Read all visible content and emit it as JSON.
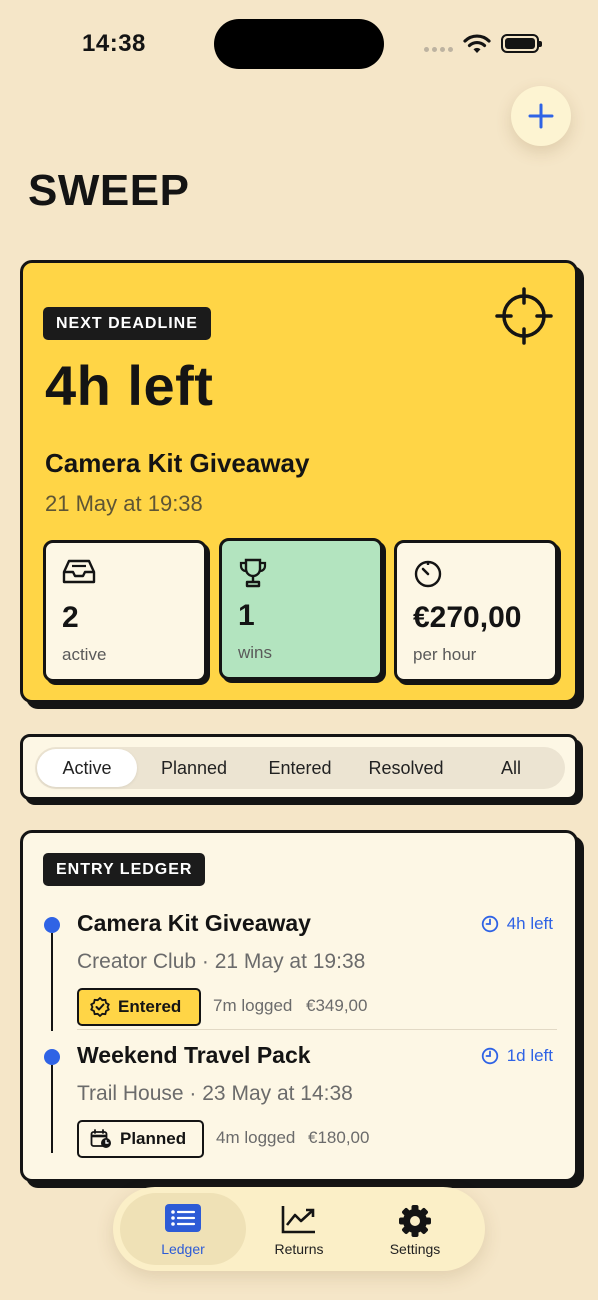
{
  "status": {
    "time": "14:38"
  },
  "header": {
    "title": "SWEEP",
    "add_icon": "plus-icon"
  },
  "hero": {
    "tag": "NEXT DEADLINE",
    "countdown": "4h left",
    "name": "Camera Kit Giveaway",
    "date": "21 May at 19:38",
    "stats": [
      {
        "value": "2",
        "label": "active",
        "icon": "inbox-icon"
      },
      {
        "value": "1",
        "label": "wins",
        "icon": "trophy-icon"
      },
      {
        "value": "€270,00",
        "label": "per hour",
        "icon": "timer-icon"
      }
    ]
  },
  "filters": {
    "selected": "Active",
    "options": [
      "Active",
      "Planned",
      "Entered",
      "Resolved",
      "All"
    ]
  },
  "ledger": {
    "tag": "ENTRY LEDGER",
    "entries": [
      {
        "title": "Camera Kit Giveaway",
        "subtitle": "Creator Club · 21 May at 19:38",
        "deadline": "4h left",
        "status": "Entered",
        "logged": "7m logged",
        "value": "€349,00"
      },
      {
        "title": "Weekend Travel Pack",
        "subtitle": "Trail House · 23 May at 14:38",
        "deadline": "1d left",
        "status": "Planned",
        "logged": "4m logged",
        "value": "€180,00"
      }
    ]
  },
  "tabs": {
    "selected": "Ledger",
    "items": [
      {
        "label": "Ledger",
        "icon": "list-icon"
      },
      {
        "label": "Returns",
        "icon": "chart-icon"
      },
      {
        "label": "Settings",
        "icon": "gear-icon"
      }
    ]
  },
  "colors": {
    "background": "#f5e6c8",
    "accent_yellow": "#ffd546",
    "accent_green": "#b3e4bf",
    "accent_blue": "#2f63e5",
    "ink": "#141414"
  }
}
